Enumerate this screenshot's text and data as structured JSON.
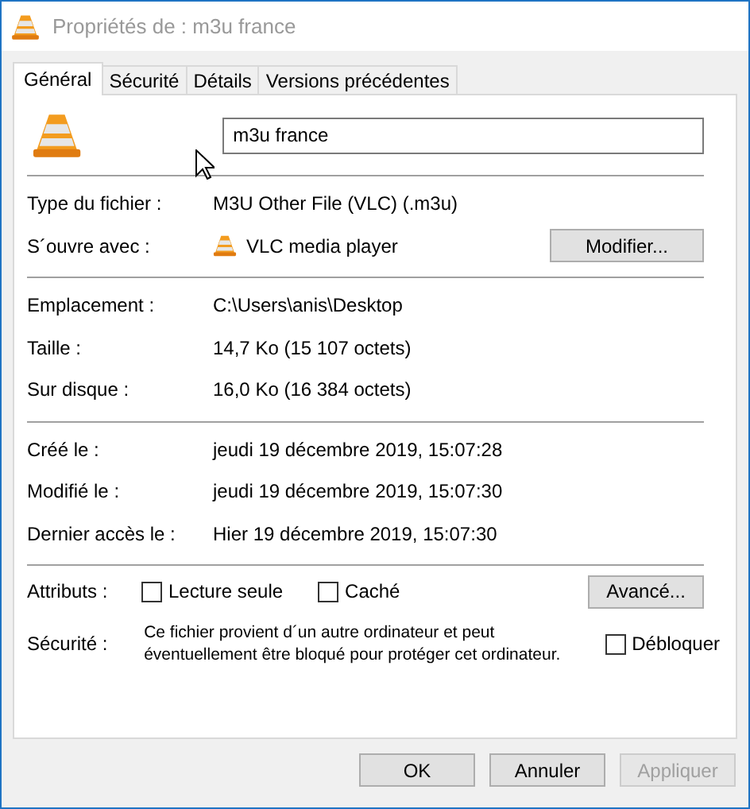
{
  "window": {
    "title": "Propriétés de : m3u france"
  },
  "tabs": [
    {
      "label": "Général",
      "selected": true
    },
    {
      "label": "Sécurité",
      "selected": false
    },
    {
      "label": "Détails",
      "selected": false
    },
    {
      "label": "Versions précédentes",
      "selected": false
    }
  ],
  "file_name": {
    "value": "m3u france"
  },
  "sections": [
    [
      {
        "kind": "text",
        "label": "Type du fichier :",
        "value": "M3U Other File (VLC) (.m3u)"
      },
      {
        "kind": "app",
        "label": "S´ouvre avec :",
        "value": "VLC media player",
        "button": "Modifier..."
      }
    ],
    [
      {
        "kind": "text",
        "label": "Emplacement :",
        "value": "C:\\Users\\anis\\Desktop"
      },
      {
        "kind": "text",
        "label": "Taille :",
        "value": "14,7 Ko (15 107 octets)"
      },
      {
        "kind": "text",
        "label": "Sur disque :",
        "value": "16,0 Ko (16 384 octets)"
      }
    ],
    [
      {
        "kind": "text",
        "label": "Créé le :",
        "value": "jeudi 19 décembre 2019, 15:07:28"
      },
      {
        "kind": "text",
        "label": "Modifié le :",
        "value": "jeudi 19 décembre 2019, 15:07:30"
      },
      {
        "kind": "text",
        "label": "Dernier accès le :",
        "value": "Hier 19 décembre 2019, 15:07:30"
      }
    ]
  ],
  "attributes": {
    "label": "Attributs :",
    "checkboxes": [
      {
        "label": "Lecture seule",
        "checked": false
      },
      {
        "label": "Caché",
        "checked": false
      }
    ],
    "button": "Avancé..."
  },
  "security": {
    "label": "Sécurité :",
    "text": "Ce fichier provient d´un autre ordinateur et peut éventuellement être bloqué pour protéger cet ordinateur.",
    "checkbox": {
      "label": "Débloquer",
      "checked": false
    }
  },
  "buttons": [
    {
      "label": "OK",
      "disabled": false
    },
    {
      "label": "Annuler",
      "disabled": false
    },
    {
      "label": "Appliquer",
      "disabled": true
    }
  ]
}
